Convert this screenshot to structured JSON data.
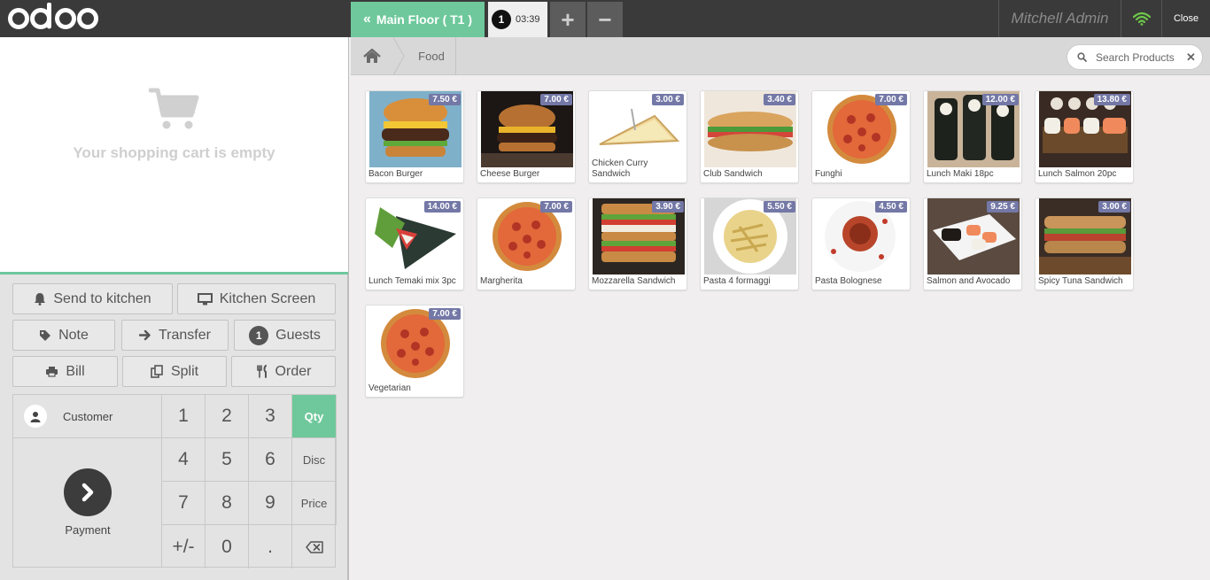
{
  "topbar": {
    "logo": "odoo",
    "floor_label": "Main Floor ( T1 )",
    "order_number": "1",
    "order_time": "03:39",
    "add_order": "+",
    "remove_order": "−",
    "user_name": "Mitchell Admin",
    "close_label": "Close"
  },
  "cart": {
    "empty_message": "Your shopping cart is empty"
  },
  "control_buttons": {
    "send_to_kitchen": "Send to kitchen",
    "kitchen_screen": "Kitchen Screen",
    "note": "Note",
    "transfer": "Transfer",
    "guests": "Guests",
    "guests_count": "1",
    "bill": "Bill",
    "split": "Split",
    "order": "Order"
  },
  "numpad": {
    "customer": "Customer",
    "payment": "Payment",
    "keys": [
      "1",
      "2",
      "3",
      "4",
      "5",
      "6",
      "7",
      "8",
      "9",
      "+/-",
      "0",
      "."
    ],
    "modes": [
      "Qty",
      "Disc",
      "Price"
    ],
    "active_mode": "Qty"
  },
  "breadcrumb": {
    "category": "Food"
  },
  "search": {
    "placeholder": "Search Products"
  },
  "products": [
    {
      "name": "Bacon Burger",
      "price": "7.50 €",
      "icon": "burger"
    },
    {
      "name": "Cheese Burger",
      "price": "7.00 €",
      "icon": "burger-dark"
    },
    {
      "name": "Chicken Curry Sandwich",
      "price": "3.00 €",
      "icon": "triangle-sandwich"
    },
    {
      "name": "Club Sandwich",
      "price": "3.40 €",
      "icon": "baguette"
    },
    {
      "name": "Funghi",
      "price": "7.00 €",
      "icon": "pizza"
    },
    {
      "name": "Lunch Maki 18pc",
      "price": "12.00 €",
      "icon": "maki"
    },
    {
      "name": "Lunch Salmon 20pc",
      "price": "13.80 €",
      "icon": "sushi"
    },
    {
      "name": "Lunch Temaki mix 3pc",
      "price": "14.00 €",
      "icon": "temaki"
    },
    {
      "name": "Margherita",
      "price": "7.00 €",
      "icon": "pizza"
    },
    {
      "name": "Mozzarella Sandwich",
      "price": "3.90 €",
      "icon": "stack-sandwich"
    },
    {
      "name": "Pasta 4 formaggi",
      "price": "5.50 €",
      "icon": "pasta"
    },
    {
      "name": "Pasta Bolognese",
      "price": "4.50 €",
      "icon": "pasta-red"
    },
    {
      "name": "Salmon and Avocado",
      "price": "9.25 €",
      "icon": "sushi-plate"
    },
    {
      "name": "Spicy Tuna Sandwich",
      "price": "3.00 €",
      "icon": "panini"
    },
    {
      "name": "Vegetarian",
      "price": "7.00 €",
      "icon": "pizza"
    }
  ],
  "colors": {
    "accent": "#6ec89b",
    "price_badge": "#7378a6",
    "topbar": "#3a3a3a"
  }
}
